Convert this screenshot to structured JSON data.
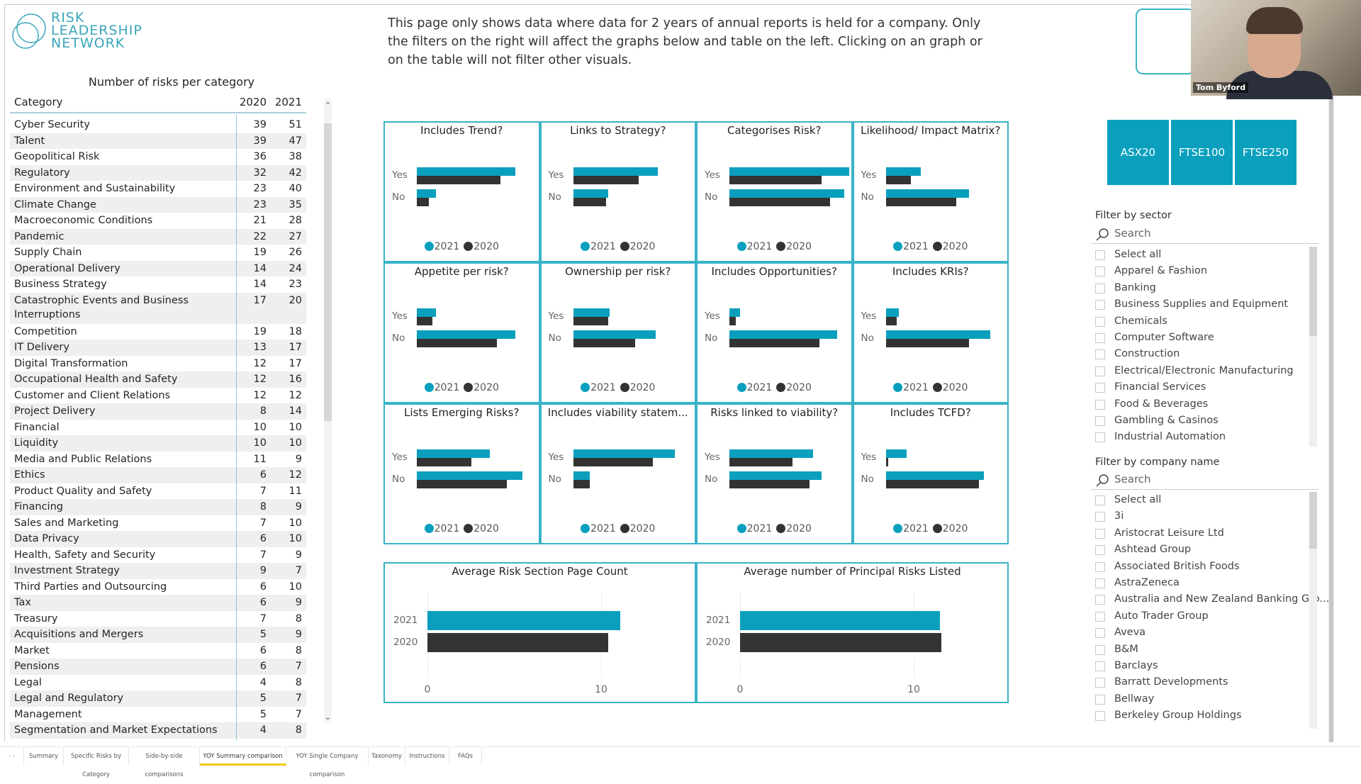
{
  "logo": {
    "lines": [
      "RISK",
      "LEADERSHIP",
      "NETWORK"
    ],
    "color": "#3aa6b9"
  },
  "description": "This page only shows data where data for 2 years of annual reports is held for a company. Only the filters on the right will affect the graphs below and table on the left. Clicking on an graph or on the table will not filter other visuals.",
  "table": {
    "title": "Number of risks per category",
    "headers": [
      "Category",
      "2020",
      "2021"
    ],
    "rows": [
      [
        "Cyber Security",
        39,
        51
      ],
      [
        "Talent",
        39,
        47
      ],
      [
        "Geopolitical Risk",
        36,
        38
      ],
      [
        "Regulatory",
        32,
        42
      ],
      [
        "Environment and Sustainability",
        23,
        40
      ],
      [
        "Climate Change",
        23,
        35
      ],
      [
        "Macroeconomic Conditions",
        21,
        28
      ],
      [
        "Pandemic",
        22,
        27
      ],
      [
        "Supply Chain",
        19,
        26
      ],
      [
        "Operational Delivery",
        14,
        24
      ],
      [
        "Business Strategy",
        14,
        23
      ],
      [
        "Catastrophic Events and Business Interruptions",
        17,
        20
      ],
      [
        "Competition",
        19,
        18
      ],
      [
        "IT Delivery",
        13,
        17
      ],
      [
        "Digital Transformation",
        12,
        17
      ],
      [
        "Occupational Health and Safety",
        12,
        16
      ],
      [
        "Customer and Client Relations",
        12,
        12
      ],
      [
        "Project Delivery",
        8,
        14
      ],
      [
        "Financial",
        10,
        10
      ],
      [
        "Liquidity",
        10,
        10
      ],
      [
        "Media and Public Relations",
        11,
        9
      ],
      [
        "Ethics",
        6,
        12
      ],
      [
        "Product Quality and Safety",
        7,
        11
      ],
      [
        "Financing",
        8,
        9
      ],
      [
        "Sales and Marketing",
        7,
        10
      ],
      [
        "Data Privacy",
        6,
        10
      ],
      [
        "Health, Safety and Security",
        7,
        9
      ],
      [
        "Investment Strategy",
        9,
        7
      ],
      [
        "Third Parties and Outsourcing",
        6,
        10
      ],
      [
        "Tax",
        6,
        9
      ],
      [
        "Treasury",
        7,
        8
      ],
      [
        "Acquisitions and Mergers",
        5,
        9
      ],
      [
        "Market",
        6,
        8
      ],
      [
        "Pensions",
        6,
        7
      ],
      [
        "Legal",
        4,
        8
      ],
      [
        "Legal and Regulatory",
        5,
        7
      ],
      [
        "Management",
        5,
        7
      ],
      [
        "Segmentation and Market Expectations",
        4,
        8
      ]
    ]
  },
  "colors": {
    "y2021": "#0aa0bd",
    "y2020": "#333333",
    "border": "#39b3c6"
  },
  "chart_data": [
    {
      "type": "bar",
      "orientation": "horizontal",
      "title": "Includes Trend?",
      "categories": [
        "Yes",
        "No"
      ],
      "note_units": "fraction of axis",
      "series": [
        {
          "name": "2021",
          "values": [
            0.81,
            0.16
          ]
        },
        {
          "name": "2020",
          "values": [
            0.69,
            0.1
          ]
        }
      ]
    },
    {
      "type": "bar",
      "orientation": "horizontal",
      "title": "Links to Strategy?",
      "categories": [
        "Yes",
        "No"
      ],
      "series": [
        {
          "name": "2021",
          "values": [
            0.7,
            0.29
          ]
        },
        {
          "name": "2020",
          "values": [
            0.54,
            0.27
          ]
        }
      ]
    },
    {
      "type": "bar",
      "orientation": "horizontal",
      "title": "Categorises Risk?",
      "categories": [
        "Yes",
        "No"
      ],
      "series": [
        {
          "name": "2021",
          "values": [
            0.99,
            0.95
          ]
        },
        {
          "name": "2020",
          "values": [
            0.76,
            0.83
          ]
        }
      ]
    },
    {
      "type": "bar",
      "orientation": "horizontal",
      "title": "Likelihood/ Impact Matrix?",
      "categories": [
        "Yes",
        "No"
      ],
      "series": [
        {
          "name": "2021",
          "values": [
            0.29,
            0.69
          ]
        },
        {
          "name": "2020",
          "values": [
            0.21,
            0.58
          ]
        }
      ]
    },
    {
      "type": "bar",
      "orientation": "horizontal",
      "title": "Appetite per risk?",
      "categories": [
        "Yes",
        "No"
      ],
      "series": [
        {
          "name": "2021",
          "values": [
            0.16,
            0.81
          ]
        },
        {
          "name": "2020",
          "values": [
            0.13,
            0.66
          ]
        }
      ]
    },
    {
      "type": "bar",
      "orientation": "horizontal",
      "title": "Ownership per risk?",
      "categories": [
        "Yes",
        "No"
      ],
      "series": [
        {
          "name": "2021",
          "values": [
            0.3,
            0.68
          ]
        },
        {
          "name": "2020",
          "values": [
            0.29,
            0.51
          ]
        }
      ]
    },
    {
      "type": "bar",
      "orientation": "horizontal",
      "title": "Includes Opportunities?",
      "categories": [
        "Yes",
        "No"
      ],
      "series": [
        {
          "name": "2021",
          "values": [
            0.09,
            0.89
          ]
        },
        {
          "name": "2020",
          "values": [
            0.05,
            0.74
          ]
        }
      ]
    },
    {
      "type": "bar",
      "orientation": "horizontal",
      "title": "Includes KRIs?",
      "categories": [
        "Yes",
        "No"
      ],
      "series": [
        {
          "name": "2021",
          "values": [
            0.11,
            0.86
          ]
        },
        {
          "name": "2020",
          "values": [
            0.09,
            0.69
          ]
        }
      ]
    },
    {
      "type": "bar",
      "orientation": "horizontal",
      "title": "Lists Emerging Risks?",
      "categories": [
        "Yes",
        "No"
      ],
      "series": [
        {
          "name": "2021",
          "values": [
            0.6,
            0.87
          ]
        },
        {
          "name": "2020",
          "values": [
            0.45,
            0.74
          ]
        }
      ]
    },
    {
      "type": "bar",
      "orientation": "horizontal",
      "title": "Includes viability statem...",
      "categories": [
        "Yes",
        "No"
      ],
      "series": [
        {
          "name": "2021",
          "values": [
            0.84,
            0.14
          ]
        },
        {
          "name": "2020",
          "values": [
            0.66,
            0.14
          ]
        }
      ]
    },
    {
      "type": "bar",
      "orientation": "horizontal",
      "title": "Risks linked to viability?",
      "categories": [
        "Yes",
        "No"
      ],
      "series": [
        {
          "name": "2021",
          "values": [
            0.69,
            0.76
          ]
        },
        {
          "name": "2020",
          "values": [
            0.52,
            0.66
          ]
        }
      ]
    },
    {
      "type": "bar",
      "orientation": "horizontal",
      "title": "Includes TCFD?",
      "categories": [
        "Yes",
        "No"
      ],
      "series": [
        {
          "name": "2021",
          "values": [
            0.17,
            0.81
          ]
        },
        {
          "name": "2020",
          "values": [
            0.02,
            0.77
          ]
        }
      ]
    },
    {
      "type": "bar",
      "orientation": "horizontal",
      "title": "Average Risk Section Page Count",
      "categories": [
        "2021",
        "2020"
      ],
      "values": [
        11.1,
        10.4
      ],
      "xticks": [
        "0",
        "10"
      ],
      "xlim": [
        0,
        14
      ]
    },
    {
      "type": "bar",
      "orientation": "horizontal",
      "title": "Average number of Principal Risks Listed",
      "categories": [
        "2021",
        "2020"
      ],
      "values": [
        11.5,
        11.6
      ],
      "xticks": [
        "0",
        "10"
      ],
      "xlim": [
        0,
        15
      ]
    }
  ],
  "legend": [
    "2021",
    "2020"
  ],
  "index_buttons": [
    "ASX20",
    "FTSE100",
    "FTSE250"
  ],
  "sector_filter": {
    "label": "Filter by sector",
    "search_placeholder": "Search",
    "items": [
      "Select all",
      "Apparel & Fashion",
      "Banking",
      "Business Supplies and Equipment",
      "Chemicals",
      "Computer Software",
      "Construction",
      "Electrical/Electronic Manufacturing",
      "Financial Services",
      "Food & Beverages",
      "Gambling & Casinos",
      "Industrial Automation"
    ]
  },
  "company_filter": {
    "label": "Filter by company name",
    "search_placeholder": "Search",
    "items": [
      "Select all",
      "3i",
      "Aristocrat Leisure Ltd",
      "Ashtead Group",
      "Associated British Foods",
      "AstraZeneca",
      "Australia and New Zealand Banking Gro...",
      "Auto Trader Group",
      "Aveva",
      "B&M",
      "Barclays",
      "Barratt Developments",
      "Bellway",
      "Berkeley Group Holdings"
    ]
  },
  "webcam": {
    "name": "Tom Byford"
  },
  "tabs": {
    "items": [
      "Summary",
      "Specific Risks by Category",
      "Side-by-side comparisons",
      "YOY Summary comparison",
      "YOY Single Company comparison",
      "Taxonomy",
      "Instructions",
      "FAQs"
    ],
    "active": "YOY Summary comparison"
  }
}
